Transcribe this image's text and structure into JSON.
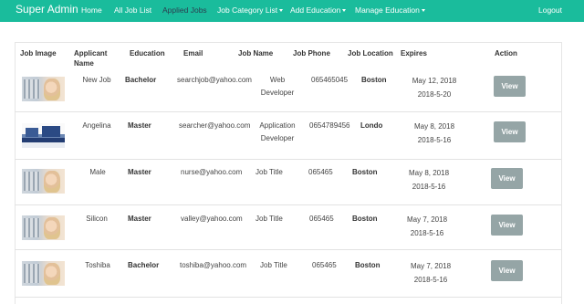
{
  "nav": {
    "brand": "Super Admin",
    "items": [
      {
        "label": "Home"
      },
      {
        "label": "All Job List"
      },
      {
        "label": "Applied Jobs"
      },
      {
        "label": "Job Category List"
      },
      {
        "label": "Add Education"
      },
      {
        "label": "Manage Education"
      }
    ],
    "logout": "Logout"
  },
  "table": {
    "headers": {
      "job_image": "Job Image",
      "applicant_name_1": "Applicant",
      "applicant_name_2": "Name",
      "education": "Education",
      "email": "Email",
      "job_name": "Job Name",
      "job_phone": "Job Phone",
      "job_location": "Job Location",
      "expires": "Expires",
      "action": "Action"
    },
    "rows": [
      {
        "applicant": "New Job",
        "education": "Bachelor",
        "email": "searchjob@yahoo.com",
        "job_name_1": "Web",
        "job_name_2": "Developer",
        "phone": "065465045",
        "location": "Boston",
        "expires_1": "May 12, 2018",
        "expires_2": "2018-5-20",
        "action": "View"
      },
      {
        "applicant": "Angelina",
        "education": "Master",
        "email": "searcher@yahoo.com",
        "job_name_1": "Application",
        "job_name_2": "Developer",
        "phone": "0654789456",
        "location": "Londo",
        "expires_1": "May 8, 2018",
        "expires_2": "2018-5-16",
        "action": "View"
      },
      {
        "applicant": "Male",
        "education": "Master",
        "email": "nurse@yahoo.com",
        "job_name_1": "Job Title",
        "job_name_2": "",
        "phone": "065465",
        "location": "Boston",
        "expires_1": "May 8, 2018",
        "expires_2": "2018-5-16",
        "action": "View"
      },
      {
        "applicant": "Silicon",
        "education": "Master",
        "email": "valley@yahoo.com",
        "job_name_1": "Job Title",
        "job_name_2": "",
        "phone": "065465",
        "location": "Boston",
        "expires_1": "May 7, 2018",
        "expires_2": "2018-5-16",
        "action": "View"
      },
      {
        "applicant": "Toshiba",
        "education": "Bachelor",
        "email": "toshiba@yahoo.com",
        "job_name_1": "Job Title",
        "job_name_2": "",
        "phone": "065465",
        "location": "Boston",
        "expires_1": "May 7, 2018",
        "expires_2": "2018-5-16",
        "action": "View"
      }
    ]
  },
  "colors": {
    "navbar": "#1abc9c",
    "active_nav": "#2c3e50",
    "button": "#95a5a6"
  }
}
